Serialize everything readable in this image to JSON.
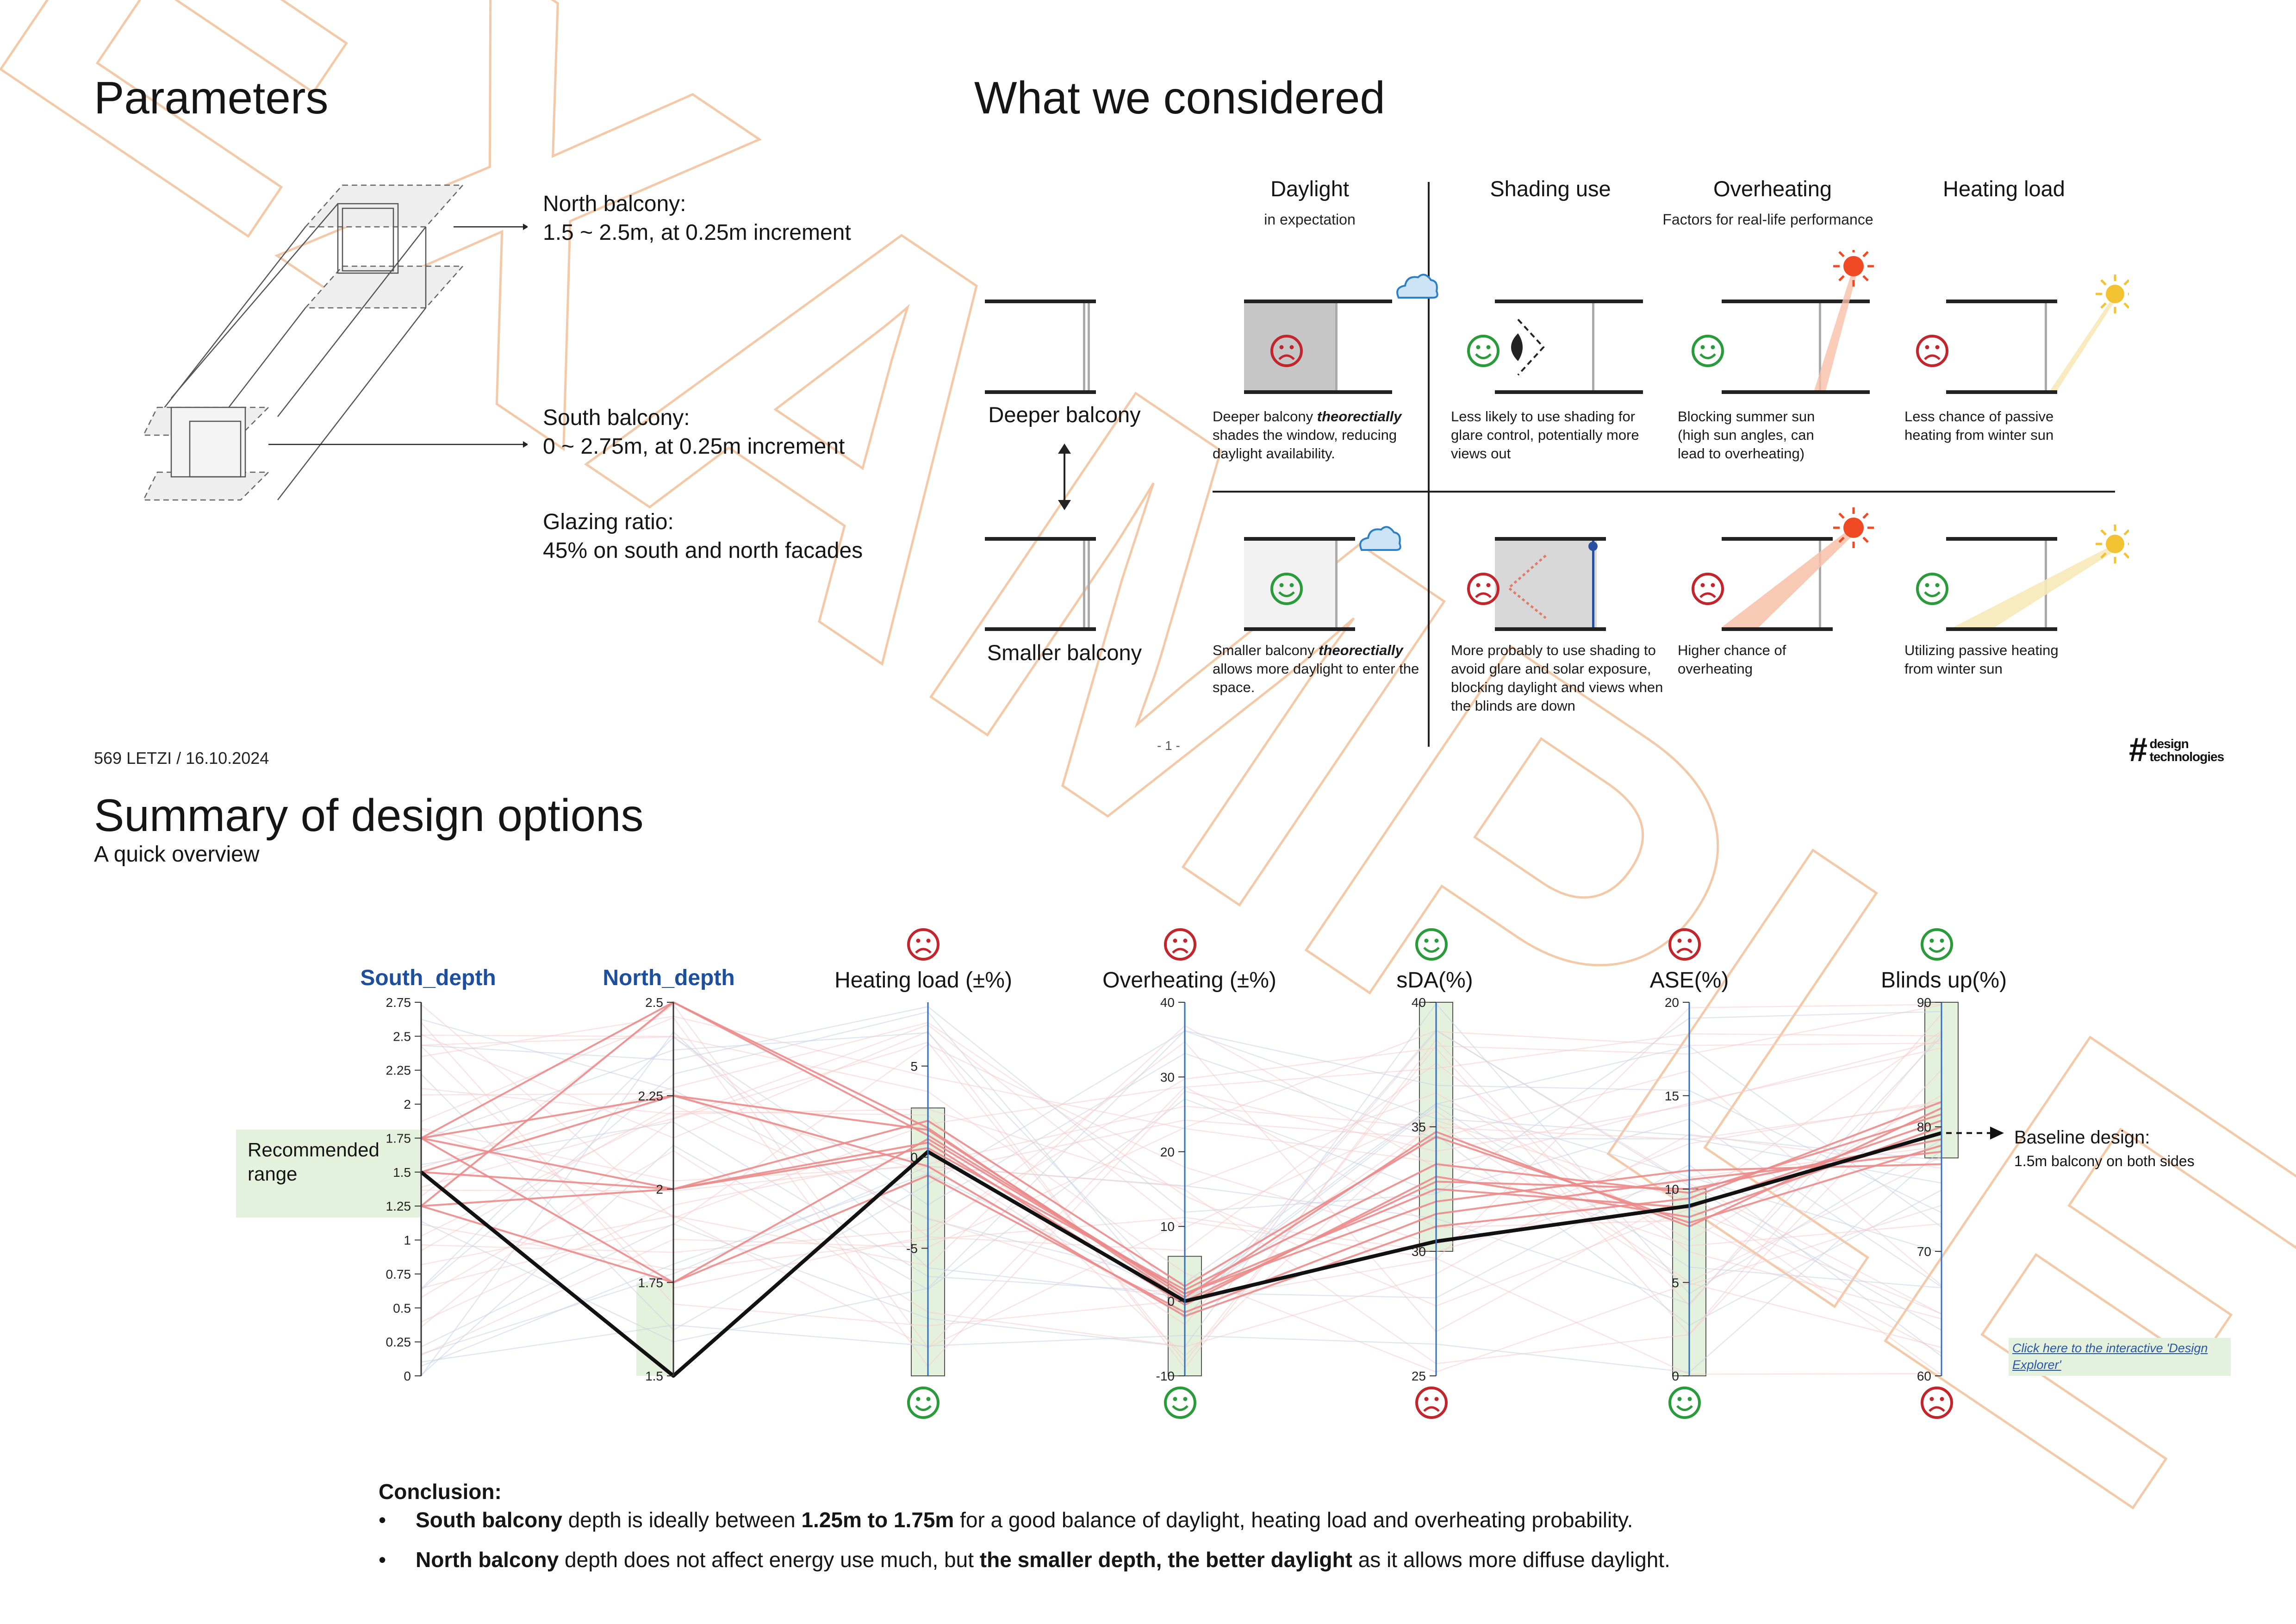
{
  "parameters": {
    "title": "Parameters",
    "north_label": "North balcony:",
    "north_range": "1.5 ~ 2.5m, at 0.25m increment",
    "south_label": "South balcony:",
    "south_range": "0 ~ 2.75m, at 0.25m increment",
    "glazing_label": "Glazing ratio:",
    "glazing_value": "45% on south and north facades"
  },
  "considered": {
    "title": "What we considered",
    "columns": [
      {
        "title": "Daylight",
        "sub": "in expectation"
      },
      {
        "title": "Shading use",
        "sub": ""
      },
      {
        "title": "Overheating",
        "sub": "Factors for real-life performance"
      },
      {
        "title": "Heating load",
        "sub": ""
      }
    ],
    "rows": [
      {
        "label": "Deeper balcony",
        "daylight": [
          "Deeper balcony ",
          "theorectially",
          " shades the window, reducing daylight availability."
        ],
        "shading": "Less likely to use shading for glare control, potentially more views out",
        "overheating": "Blocking summer sun (high sun angles, can lead to overheating)",
        "heating": "Less chance of passive heating from winter sun"
      },
      {
        "label": "Smaller balcony",
        "daylight": [
          "Smaller balcony ",
          "theorectially",
          " allows more daylight to enter the space."
        ],
        "shading": "More probably to use shading to avoid glare and solar exposure, blocking daylight and views when the blinds are down",
        "overheating": "Higher chance of overheating",
        "heating": "Utilizing passive heating from winter sun"
      }
    ]
  },
  "footer": {
    "left": "569 LETZI / 16.10.2024",
    "page": "- 1 -",
    "logo_mark": "#",
    "logo_line1": "design",
    "logo_line2": "technologies"
  },
  "watermark": "EXAMPLE",
  "summary": {
    "title": "Summary of design options",
    "subtitle": "A quick overview",
    "recommended_label": "Recommended range",
    "baseline_title": "Baseline design:",
    "baseline_sub": "1.5m balcony on both sides",
    "link_text": "Click here to the interactive 'Design Explorer'"
  },
  "chart_data": {
    "type": "parallel-coordinates",
    "axes": [
      {
        "name": "South_depth",
        "min": 0,
        "max": 2.75,
        "ticks": [
          "0",
          "0.25",
          "0.5",
          "0.75",
          "1",
          "1.25",
          "1.5",
          "1.75",
          "2",
          "2.25",
          "2.5",
          "2.75"
        ],
        "top_face": "",
        "bottom_face": "",
        "highlight": [
          1.25,
          1.75
        ]
      },
      {
        "name": "North_depth",
        "min": 1.5,
        "max": 2.5,
        "ticks": [
          "1.5",
          "1.75",
          "2",
          "2.25",
          "2.5"
        ],
        "top_face": "",
        "bottom_face": "",
        "highlight": [
          1.5,
          1.75
        ]
      },
      {
        "name": "Heating load (±%)",
        "min": -12,
        "max": 8.5,
        "ticks": [
          "-5",
          "0",
          "5"
        ],
        "tick_values": [
          -5,
          0,
          5
        ],
        "top_face": "sad",
        "bottom_face": "happy",
        "highlight": [
          -12,
          2.7
        ]
      },
      {
        "name": "Overheating (±%)",
        "min": -10,
        "max": 40,
        "ticks": [
          "-10",
          "0",
          "10",
          "20",
          "30",
          "40"
        ],
        "top_face": "sad",
        "bottom_face": "happy",
        "highlight": [
          -10,
          6
        ]
      },
      {
        "name": "sDA(%)",
        "min": 25,
        "max": 40,
        "ticks": [
          "25",
          "30",
          "35",
          "40"
        ],
        "top_face": "happy",
        "bottom_face": "sad",
        "highlight": [
          30,
          40
        ]
      },
      {
        "name": "ASE(%)",
        "min": 0,
        "max": 20,
        "ticks": [
          "0",
          "5",
          "10",
          "15",
          "20"
        ],
        "top_face": "sad",
        "bottom_face": "happy",
        "highlight": [
          0,
          10
        ]
      },
      {
        "name": "Blinds up(%)",
        "min": 60,
        "max": 90,
        "ticks": [
          "60",
          "70",
          "80",
          "90"
        ],
        "top_face": "happy",
        "bottom_face": "sad",
        "highlight": [
          77.5,
          90
        ]
      }
    ],
    "baseline": [
      1.5,
      1.5,
      0.3,
      0,
      30.4,
      9.1,
      79.5
    ],
    "recommended": [
      [
        1.75,
        2.5,
        1.2,
        1,
        32.5,
        9.0,
        80.5
      ],
      [
        1.75,
        2.25,
        1.5,
        0.5,
        34.8,
        8.0,
        81.5
      ],
      [
        1.5,
        2.0,
        0.8,
        -0.5,
        33.0,
        8.5,
        80.0
      ],
      [
        1.25,
        1.75,
        -1.0,
        -1.5,
        31.5,
        10.5,
        78.0
      ],
      [
        1.25,
        2.0,
        2.0,
        2.0,
        34.6,
        8.2,
        78.5
      ],
      [
        1.75,
        1.75,
        1.0,
        1.0,
        32.0,
        11.0,
        77.0
      ],
      [
        1.5,
        2.25,
        -0.5,
        -2.0,
        31.0,
        9.5,
        82.0
      ],
      [
        1.25,
        2.5,
        1.6,
        0.0,
        32.8,
        10.0,
        79.0
      ],
      [
        1.75,
        2.0,
        0.5,
        1.5,
        33.5,
        9.8,
        81.0
      ]
    ],
    "other_count": 40
  },
  "conclusion": {
    "title": "Conclusion:",
    "bullets": [
      [
        [
          "South balcony",
          true
        ],
        [
          " depth is ideally between ",
          false
        ],
        [
          "1.25m to 1.75m",
          true
        ],
        [
          " for a good balance of daylight, heating load and overheating probability.",
          false
        ]
      ],
      [
        [
          "North balcony",
          true
        ],
        [
          " depth does not affect energy use much, but ",
          false
        ],
        [
          "the smaller depth, the better daylight",
          true
        ],
        [
          " as it allows more diffuse daylight.",
          false
        ]
      ]
    ]
  },
  "colors": {
    "happy": "#2a9a3a",
    "sad": "#c0262c",
    "sun_red": "#ef4a23",
    "sun_yellow": "#f1c232",
    "axis_blue": "#2f6fc2",
    "highlight_green": "#e4f1dc",
    "recommended_line": "#ea8b8b",
    "baseline_line": "#111111",
    "watermark": "#f3c9a8"
  }
}
